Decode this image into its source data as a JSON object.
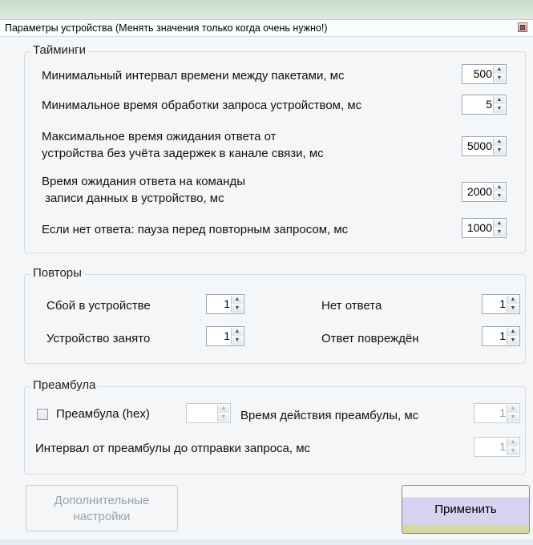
{
  "window": {
    "title": "Параметры устройства (Менять значения только когда очень нужно!)",
    "close_glyph": "⊠"
  },
  "timings": {
    "legend": "Тайминги",
    "rows": [
      {
        "label": "Минимальный интервал времени между пакетами, мс",
        "value": "500"
      },
      {
        "label": "Минимальное время обработки запроса устройством, мс",
        "value": "5"
      },
      {
        "label_line1": "Максимальное время ожидания ответа от",
        "label_line2": "устройства без учёта задержек в канале связи, мс",
        "value": "5000"
      },
      {
        "label_line1": "Время ожидания ответа на команды",
        "label_line2": " записи данных в устройство, мс",
        "value": "2000"
      },
      {
        "label": "Если нет ответа: пауза перед повторным запросом, мс",
        "value": "1000"
      }
    ]
  },
  "retries": {
    "legend": "Повторы",
    "device_failure": {
      "label": "Сбой в устройстве",
      "value": "1"
    },
    "no_response": {
      "label": "Нет ответа",
      "value": "1"
    },
    "device_busy": {
      "label": "Устройство занято",
      "value": "1"
    },
    "response_damaged": {
      "label": "Ответ повреждён",
      "value": "1"
    }
  },
  "preamble": {
    "legend": "Преамбула",
    "hex_label": "Преамбула (hex)",
    "hex_checked": false,
    "hex_value": "",
    "duration_label": "Время действия преамбулы, мс",
    "duration_value": "1",
    "interval_label": "Интервал от преамбулы до отправки запроса, мс",
    "interval_value": "1"
  },
  "buttons": {
    "advanced_line1": "Дополнительные",
    "advanced_line2": "настройки",
    "apply": "Применить"
  },
  "spin_glyphs": {
    "up": "▲",
    "down": "▼"
  }
}
